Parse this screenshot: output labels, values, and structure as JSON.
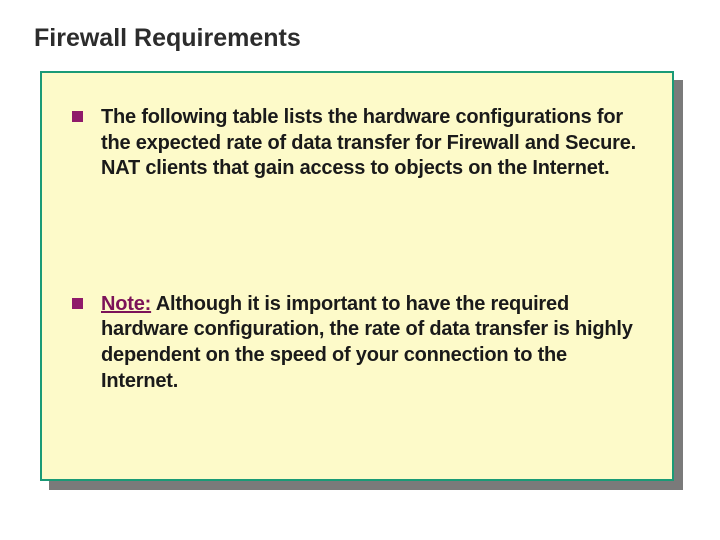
{
  "title": "Firewall Requirements",
  "items": [
    {
      "text": "The following table lists the hardware configurations for the expected rate of data transfer for Firewall and Secure. NAT clients that gain access to objects on the Internet."
    },
    {
      "note_label": "Note:",
      "text": " Although it is important to have the required hardware configuration, the rate of data transfer is highly dependent on the speed of your connection to the Internet."
    }
  ]
}
